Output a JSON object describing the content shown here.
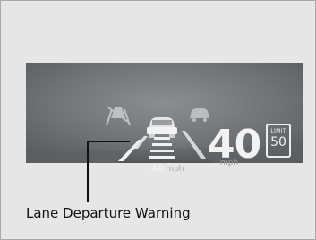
{
  "hud": {
    "current_speed": "40",
    "speed_unit": "mph",
    "acc_set_speed": "40",
    "acc_unit": "mph",
    "speed_limit_label": "LIMIT",
    "speed_limit_value": "50"
  },
  "caption": "Lane Departure Warning",
  "colors": {
    "background": "#e6e6e6",
    "hud_background": "#6e7275",
    "hud_text": "#f2f2f2"
  },
  "icons": [
    "lane-keep-off-icon",
    "vehicle-ahead-icon",
    "lane-marking-icon",
    "lead-car-icon"
  ]
}
